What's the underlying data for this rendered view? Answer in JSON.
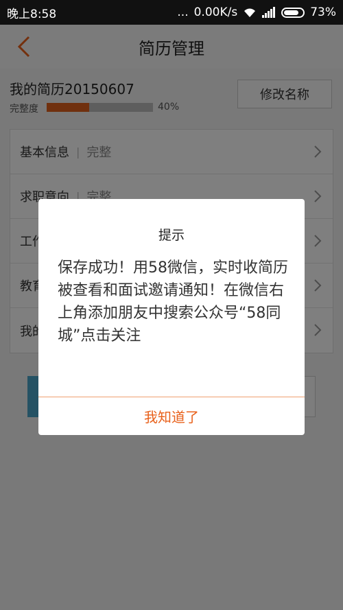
{
  "status_bar": {
    "time": "晚上8:58",
    "dots": "...",
    "speed": "0.00K/s",
    "battery": "73%"
  },
  "nav": {
    "title": "简历管理"
  },
  "resume": {
    "name": "我的简历20150607",
    "progress_label": "完整度",
    "progress_percent": "40%",
    "progress_value": 0.4,
    "rename_label": "修改名称"
  },
  "list": {
    "items": [
      {
        "label": "基本信息",
        "status": "完整"
      },
      {
        "label": "求职意向",
        "status": "完整"
      },
      {
        "label": "工作经历",
        "status": ""
      },
      {
        "label": "教育经历",
        "status": ""
      },
      {
        "label": "我的",
        "status": ""
      }
    ]
  },
  "dialog": {
    "title": "提示",
    "message": "保存成功！用58微信，实时收简历被查看和面试邀请通知！在微信右上角添加朋友中搜索公众号“58同城”点击关注",
    "button": "我知道了"
  },
  "colors": {
    "accent": "#e8601a",
    "progress_fill": "#e0601c",
    "button_blue": "#4aa4c8"
  }
}
